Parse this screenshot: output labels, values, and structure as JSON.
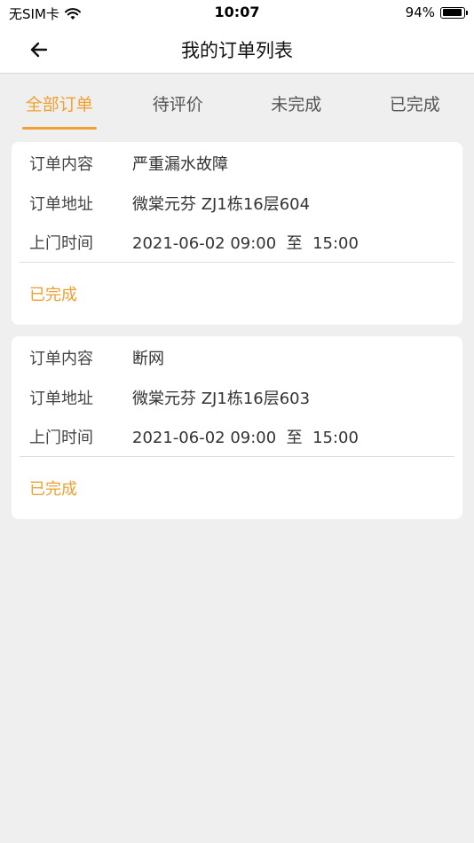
{
  "statusbar": {
    "carrier": "无SIM卡",
    "time": "10:07",
    "battery_text": "94%",
    "battery_level": 0.94
  },
  "navbar": {
    "title": "我的订单列表"
  },
  "tabs": [
    {
      "label": "全部订单",
      "active": true
    },
    {
      "label": "待评价",
      "active": false
    },
    {
      "label": "未完成",
      "active": false
    },
    {
      "label": "已完成",
      "active": false
    }
  ],
  "colors": {
    "accent": "#f0a030",
    "background": "#efefef",
    "card": "#ffffff"
  },
  "orders": [
    {
      "content_label": "订单内容",
      "content": "严重漏水故障",
      "address_label": "订单地址",
      "address": "微棠元芬 ZJ1栋16层604",
      "time_label": "上门时间",
      "time": "2021-06-02 09:00  至  15:00",
      "status": "已完成"
    },
    {
      "content_label": "订单内容",
      "content": "断网",
      "address_label": "订单地址",
      "address": "微棠元芬 ZJ1栋16层603",
      "time_label": "上门时间",
      "time": "2021-06-02 09:00  至  15:00",
      "status": "已完成"
    }
  ]
}
